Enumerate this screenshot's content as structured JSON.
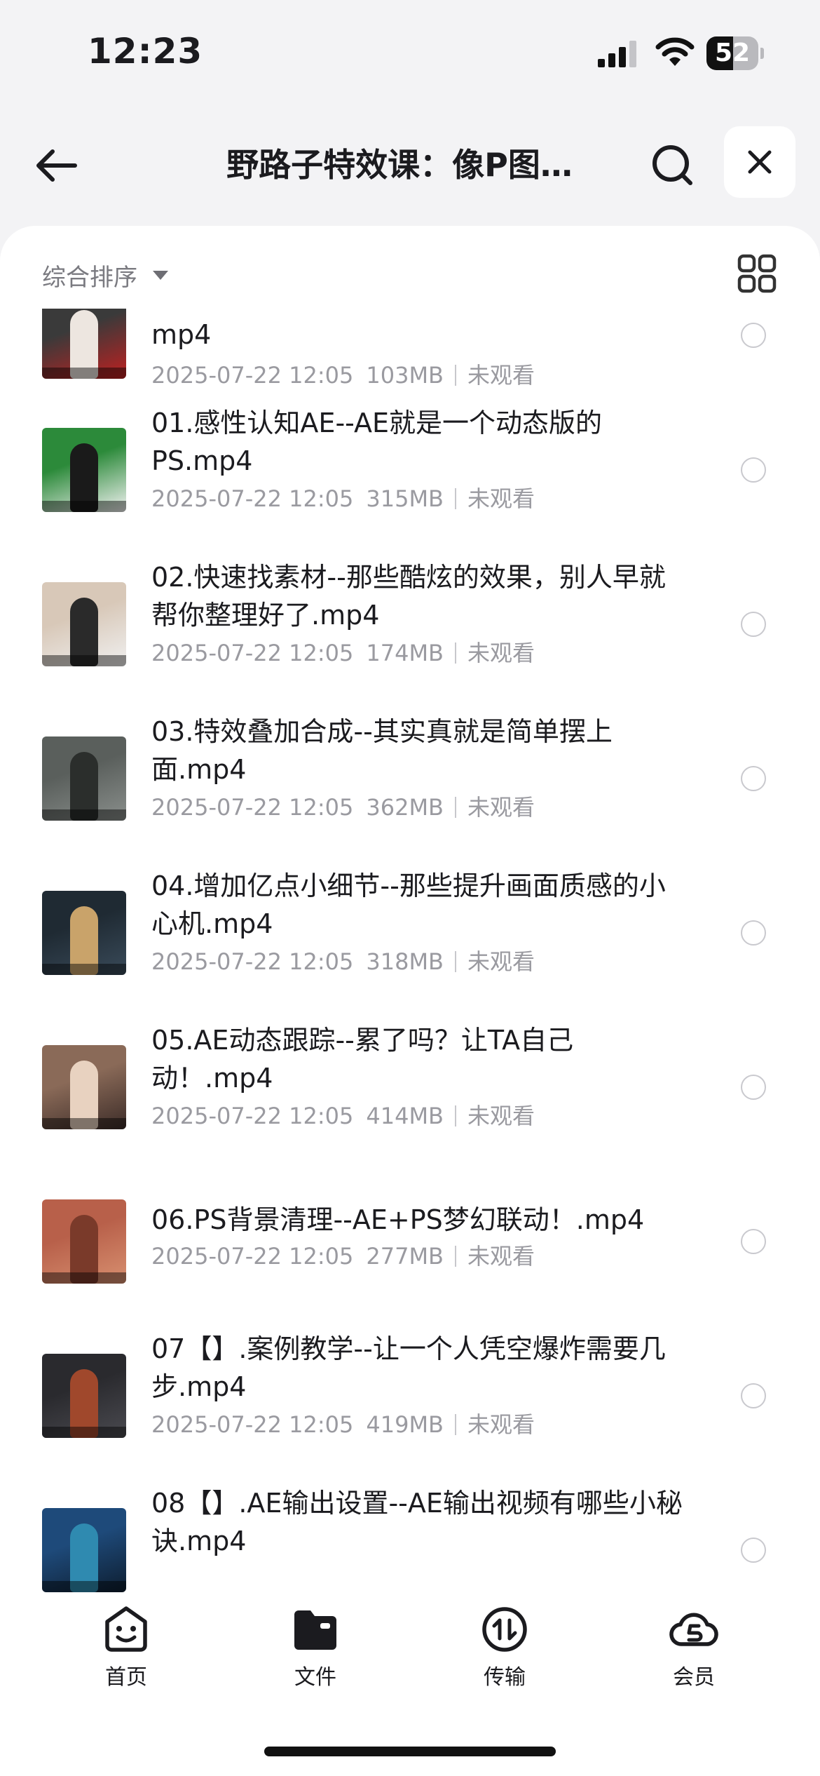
{
  "status_bar": {
    "time": "12:23",
    "battery": "52",
    "battery_level": 0.52
  },
  "header": {
    "title": "野路子特效课：像P图…"
  },
  "toolbar": {
    "sort_label": "综合排序"
  },
  "files": [
    {
      "name": "mp4",
      "date": "2025-07-22 12:05",
      "size": "103MB",
      "status": "未观看",
      "thumb_colors": [
        "#3a3a3a",
        "#ede6e0",
        "#c02020"
      ]
    },
    {
      "name": "01.感性认知AE--AE就是一个动态版的PS.mp4",
      "date": "2025-07-22 12:05",
      "size": "315MB",
      "status": "未观看",
      "thumb_colors": [
        "#2c8a3a",
        "#1a1a1a",
        "#f2f2f2"
      ]
    },
    {
      "name": "02.快速找素材--那些酷炫的效果，别人早就帮你整理好了.mp4",
      "date": "2025-07-22 12:05",
      "size": "174MB",
      "status": "未观看",
      "thumb_colors": [
        "#d8c8b8",
        "#2a2a2a",
        "#f0f0f0"
      ]
    },
    {
      "name": "03.特效叠加合成--其实真就是简单摆上面.mp4",
      "date": "2025-07-22 12:05",
      "size": "362MB",
      "status": "未观看",
      "thumb_colors": [
        "#5a5f5c",
        "#2b2e2c",
        "#8a8f8c"
      ]
    },
    {
      "name": "04.增加亿点小细节--那些提升画面质感的小心机.mp4",
      "date": "2025-07-22 12:05",
      "size": "318MB",
      "status": "未观看",
      "thumb_colors": [
        "#1f2a33",
        "#c9a36a",
        "#3a4b5a"
      ]
    },
    {
      "name": "05.AE动态跟踪--累了吗？让TA自己动！.mp4",
      "date": "2025-07-22 12:05",
      "size": "414MB",
      "status": "未观看",
      "thumb_colors": [
        "#8a6a58",
        "#e8d2c0",
        "#3c2c28"
      ]
    },
    {
      "name": "06.PS背景清理--AE+PS梦幻联动！.mp4",
      "date": "2025-07-22 12:05",
      "size": "277MB",
      "status": "未观看",
      "thumb_colors": [
        "#b8604a",
        "#7a3a2a",
        "#d89070"
      ]
    },
    {
      "name": "07【】.案例教学--让一个人凭空爆炸需要几步.mp4",
      "date": "2025-07-22 12:05",
      "size": "419MB",
      "status": "未观看",
      "thumb_colors": [
        "#2a2a2e",
        "#a0482c",
        "#4a4a50"
      ]
    },
    {
      "name": "08【】.AE输出设置--AE输出视频有哪些小秘诀.mp4",
      "date": "",
      "size": "",
      "status": "",
      "thumb_colors": [
        "#1e4a7a",
        "#2f8ab0",
        "#0e1e30"
      ]
    }
  ],
  "tabs": [
    {
      "label": "首页",
      "icon": "smiley-icon"
    },
    {
      "label": "文件",
      "icon": "folder-icon"
    },
    {
      "label": "传输",
      "icon": "transfer-icon"
    },
    {
      "label": "会员",
      "icon": "cloud-icon"
    }
  ]
}
